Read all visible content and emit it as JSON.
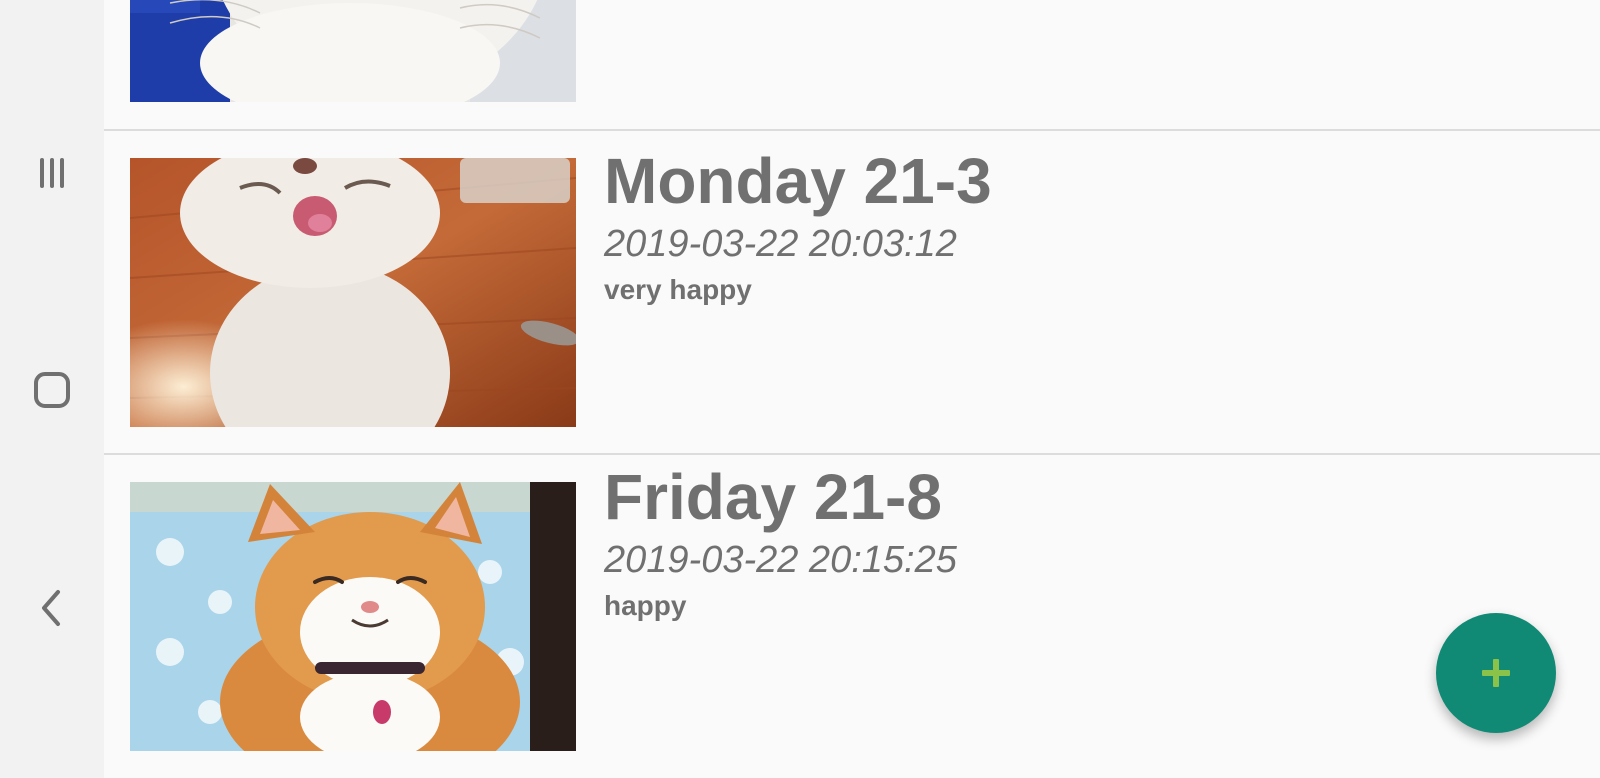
{
  "navigation_bar": {
    "recents_icon": "recents-icon",
    "home_icon": "home-icon",
    "back_icon": "back-icon"
  },
  "entries": [
    {
      "title": "",
      "timestamp": "",
      "mood": "",
      "thumbnail": "white-cat-photo"
    },
    {
      "title": "Monday 21-3",
      "timestamp": "2019-03-22 20:03:12",
      "mood": "very happy",
      "thumbnail": "smiling-white-cat-photo"
    },
    {
      "title": "Friday 21-8",
      "timestamp": "2019-03-22 20:15:25",
      "mood": "happy",
      "thumbnail": "smiling-orange-cat-photo"
    }
  ],
  "fab": {
    "icon": "plus-icon",
    "background_color": "#118a75",
    "icon_color": "#8bc34a"
  },
  "colors": {
    "text": "#707070",
    "background": "#fafafa",
    "divider": "#dcdcdc"
  }
}
